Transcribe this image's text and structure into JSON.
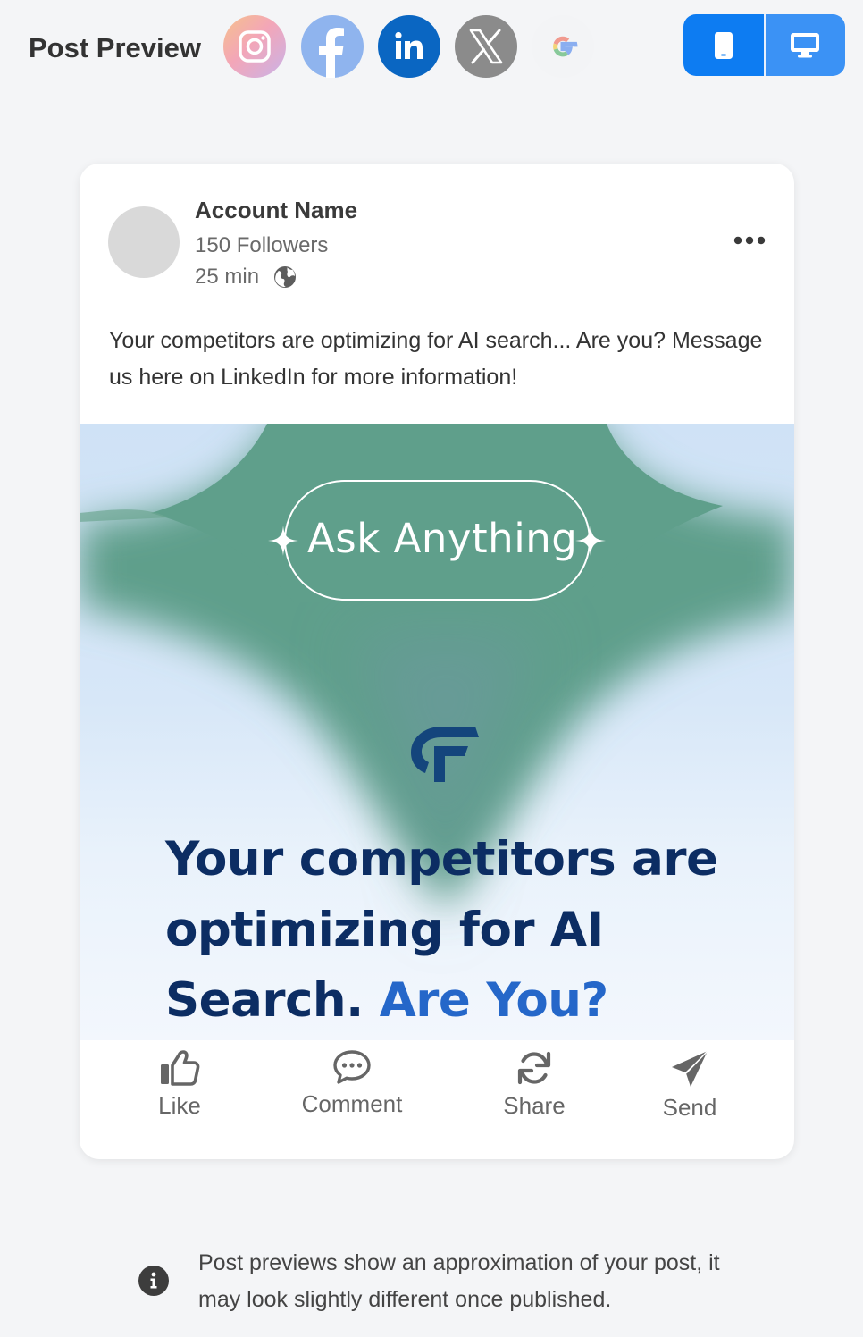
{
  "header": {
    "title": "Post Preview",
    "platforms": [
      {
        "name": "instagram",
        "icon": "instagram-icon"
      },
      {
        "name": "facebook",
        "icon": "facebook-icon"
      },
      {
        "name": "linkedin",
        "icon": "linkedin-icon",
        "selected": true
      },
      {
        "name": "x",
        "icon": "x-icon"
      },
      {
        "name": "google",
        "icon": "google-icon"
      }
    ],
    "device_toggle": {
      "selected": "mobile",
      "options": [
        "mobile",
        "desktop"
      ]
    }
  },
  "post": {
    "account_name": "Account Name",
    "followers": "150 Followers",
    "time": "25 min",
    "text": "Your competitors are optimizing for AI search... Are you? Message us here on LinkedIn for more information!",
    "image": {
      "pill_text": "Ask Anything",
      "headline_main": "Your competitors are optimizing for AI Search.",
      "headline_accent": "Are You?"
    },
    "actions": {
      "like": "Like",
      "comment": "Comment",
      "share": "Share",
      "send": "Send"
    }
  },
  "notice": {
    "text": "Post previews show an approximation of your post, it may look slightly different once published."
  },
  "colors": {
    "primary": "#0d7cf2",
    "linkedin": "#0a66c2",
    "headline": "#0c2d63",
    "headline_accent": "#2567c9",
    "image_teal": "#5f9e8a"
  }
}
